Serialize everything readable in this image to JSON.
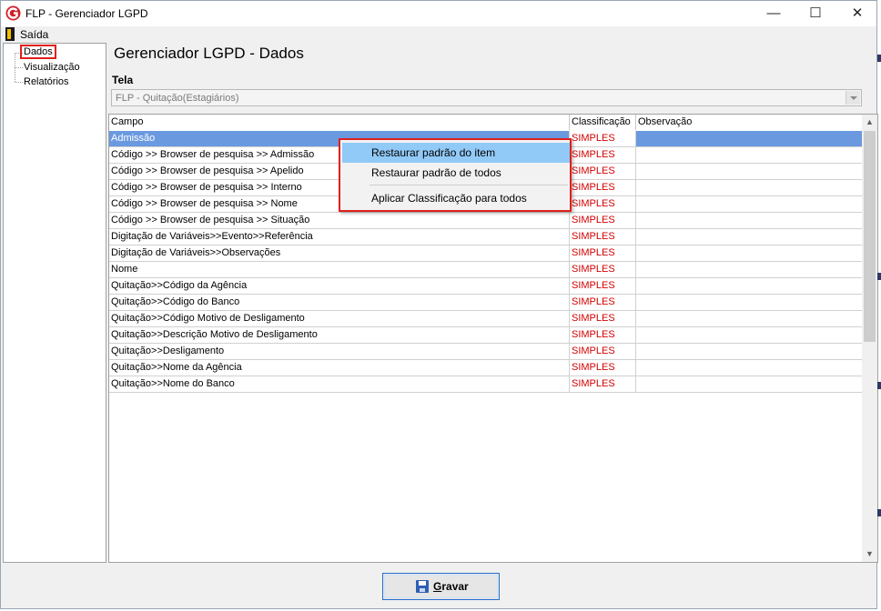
{
  "window": {
    "title": "FLP - Gerenciador LGPD",
    "minimize_glyph": "—",
    "maximize_glyph": "☐",
    "close_glyph": "✕",
    "app_icon": "flp-logo-icon"
  },
  "menu": {
    "exit_label": "Saída",
    "exit_icon": "door-exit-icon"
  },
  "sidebar": {
    "items": [
      {
        "label": "Dados",
        "selected": true
      },
      {
        "label": "Visualização"
      },
      {
        "label": "Relatórios"
      }
    ]
  },
  "main": {
    "heading": "Gerenciador LGPD - Dados",
    "tela_label": "Tela",
    "tela_value": "FLP - Quitação(Estagiários)"
  },
  "grid": {
    "columns": [
      "Campo",
      "Classificação",
      "Observação"
    ],
    "rows": [
      {
        "campo": "Admissão",
        "classificacao": "SIMPLES",
        "observacao": ""
      },
      {
        "campo": "Código >> Browser de pesquisa >> Admissão",
        "classificacao": "SIMPLES",
        "observacao": ""
      },
      {
        "campo": "Código >> Browser de pesquisa >> Apelido",
        "classificacao": "SIMPLES",
        "observacao": ""
      },
      {
        "campo": "Código >> Browser de pesquisa >> Interno",
        "classificacao": "SIMPLES",
        "observacao": ""
      },
      {
        "campo": "Código >> Browser de pesquisa >> Nome",
        "classificacao": "SIMPLES",
        "observacao": ""
      },
      {
        "campo": "Código >> Browser de pesquisa >> Situação",
        "classificacao": "SIMPLES",
        "observacao": ""
      },
      {
        "campo": "Digitação de Variáveis>>Evento>>Referência",
        "classificacao": "SIMPLES",
        "observacao": ""
      },
      {
        "campo": "Digitação de Variáveis>>Observações",
        "classificacao": "SIMPLES",
        "observacao": ""
      },
      {
        "campo": "Nome",
        "classificacao": "SIMPLES",
        "observacao": ""
      },
      {
        "campo": "Quitação>>Código da Agência",
        "classificacao": "SIMPLES",
        "observacao": ""
      },
      {
        "campo": "Quitação>>Código do Banco",
        "classificacao": "SIMPLES",
        "observacao": ""
      },
      {
        "campo": "Quitação>>Código Motivo de Desligamento",
        "classificacao": "SIMPLES",
        "observacao": ""
      },
      {
        "campo": "Quitação>>Descrição Motivo de Desligamento",
        "classificacao": "SIMPLES",
        "observacao": ""
      },
      {
        "campo": "Quitação>>Desligamento",
        "classificacao": "SIMPLES",
        "observacao": ""
      },
      {
        "campo": "Quitação>>Nome da Agência",
        "classificacao": "SIMPLES",
        "observacao": ""
      },
      {
        "campo": "Quitação>>Nome do Banco",
        "classificacao": "SIMPLES",
        "observacao": ""
      }
    ],
    "selected_row": 0
  },
  "context_menu": {
    "items": [
      "Restaurar padrão do item",
      "Restaurar padrão de todos",
      "Aplicar Classificação para todos"
    ],
    "highlighted": 0
  },
  "footer": {
    "save_label_first": "G",
    "save_label_rest": "ravar",
    "save_icon": "floppy-disk-icon"
  },
  "colors": {
    "classification_text": "#d40000",
    "selection": "#6a99e0",
    "highlight_box": "#e0201e",
    "menu_hover": "#91c9f7"
  }
}
